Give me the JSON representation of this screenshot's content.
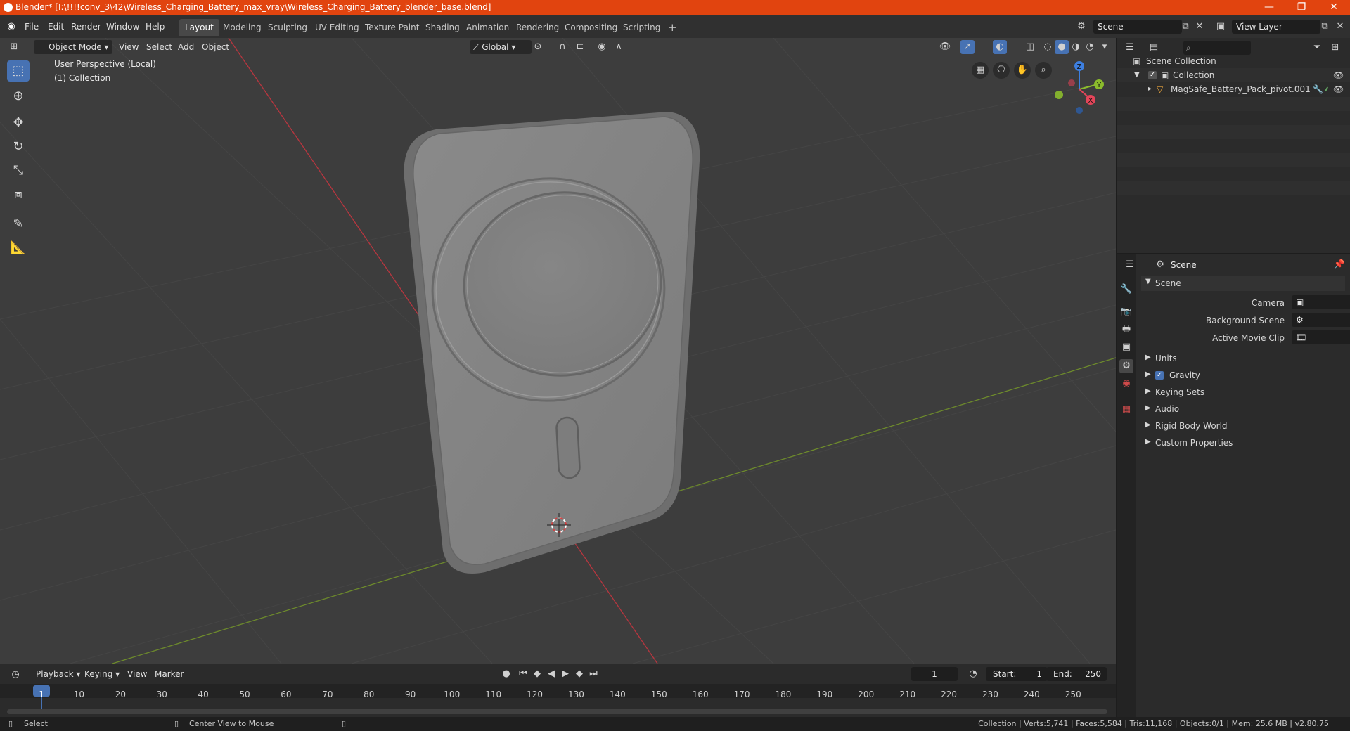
{
  "window": {
    "title": "Blender* [I:\\!!!!conv_3\\42\\Wireless_Charging_Battery_max_vray\\Wireless_Charging_Battery_blender_base.blend]",
    "minimize": "—",
    "maximize": "❐",
    "close": "✕"
  },
  "menubar": {
    "menus": [
      "File",
      "Edit",
      "Render",
      "Window",
      "Help"
    ],
    "tabs": [
      "Layout",
      "Modeling",
      "Sculpting",
      "UV Editing",
      "Texture Paint",
      "Shading",
      "Animation",
      "Rendering",
      "Compositing",
      "Scripting"
    ],
    "add_tab": "+",
    "scene_label": "Scene",
    "view_layer_label": "View Layer"
  },
  "viewport": {
    "mode": "Object Mode",
    "menus": [
      "View",
      "Select",
      "Add",
      "Object"
    ],
    "transform": "Global",
    "overlay_line1": "User Perspective (Local)",
    "overlay_line2": "(1) Collection",
    "gizmo": {
      "z": "Z",
      "y": "Y",
      "x": "X"
    }
  },
  "timeline": {
    "menus": [
      "Playback",
      "Keying",
      "View",
      "Marker"
    ],
    "current_frame": "1",
    "start_label": "Start:",
    "start_value": "1",
    "end_label": "End:",
    "end_value": "250",
    "ruler": [
      "1",
      "10",
      "20",
      "30",
      "40",
      "50",
      "60",
      "70",
      "80",
      "90",
      "100",
      "110",
      "120",
      "130",
      "140",
      "150",
      "160",
      "170",
      "180",
      "190",
      "200",
      "210",
      "220",
      "230",
      "240",
      "250"
    ]
  },
  "outliner": {
    "search_placeholder": "",
    "scene_collection": "Scene Collection",
    "collection": "Collection",
    "object": "MagSafe_Battery_Pack_pivot.001"
  },
  "properties": {
    "breadcrumb": "Scene",
    "panel_title": "Scene",
    "camera_label": "Camera",
    "background_scene_label": "Background Scene",
    "active_movie_clip_label": "Active Movie Clip",
    "sections": [
      "Units",
      "Gravity",
      "Keying Sets",
      "Audio",
      "Rigid Body World",
      "Custom Properties"
    ]
  },
  "statusbar": {
    "select": "Select",
    "center_view": "Center View to Mouse",
    "stats": "Collection | Verts:5,741 | Faces:5,584 | Tris:11,168 | Objects:0/1 | Mem: 25.6 MB | v2.80.75"
  },
  "colors": {
    "accent": "#4772b3",
    "titlebar": "#e1440f",
    "viewport_bg": "#3d3d3d",
    "axis_x": "#b8363f",
    "axis_y": "#6d8a2c"
  }
}
